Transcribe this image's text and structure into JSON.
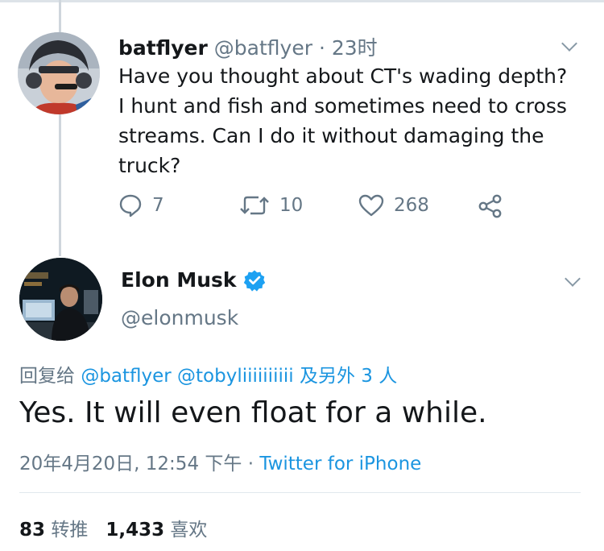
{
  "reply_tweet": {
    "name": "batflyer",
    "handle": "@batflyer",
    "separator": "·",
    "time": "23时",
    "text": "Have you thought about CT's wading depth? I hunt and fish and sometimes need to cross streams. Can I do it without damaging the truck?",
    "actions": {
      "replies_icon": "reply-icon",
      "replies": "7",
      "retweets_icon": "retweet-icon",
      "retweets": "10",
      "likes_icon": "heart-icon",
      "likes": "268",
      "share_icon": "share-icon"
    }
  },
  "main_tweet": {
    "name": "Elon Musk",
    "verified_icon": "verified-badge-icon",
    "handle": "@elonmusk",
    "reply_prefix": "回复给",
    "reply_mentions": "@batflyer @tobyliiiiiiiiii",
    "reply_suffix": "及另外 3 人",
    "text": "Yes. It will even float for a while.",
    "date": "20年4月20日, 12:54 下午",
    "separator": "·",
    "source": "Twitter for iPhone",
    "stats": {
      "retweets": "83",
      "retweets_label": "转推",
      "likes": "1,433",
      "likes_label": "喜欢"
    }
  },
  "colors": {
    "text": "#14171a",
    "muted": "#657786",
    "link": "#1b95e0",
    "verified": "#1da1f2"
  }
}
